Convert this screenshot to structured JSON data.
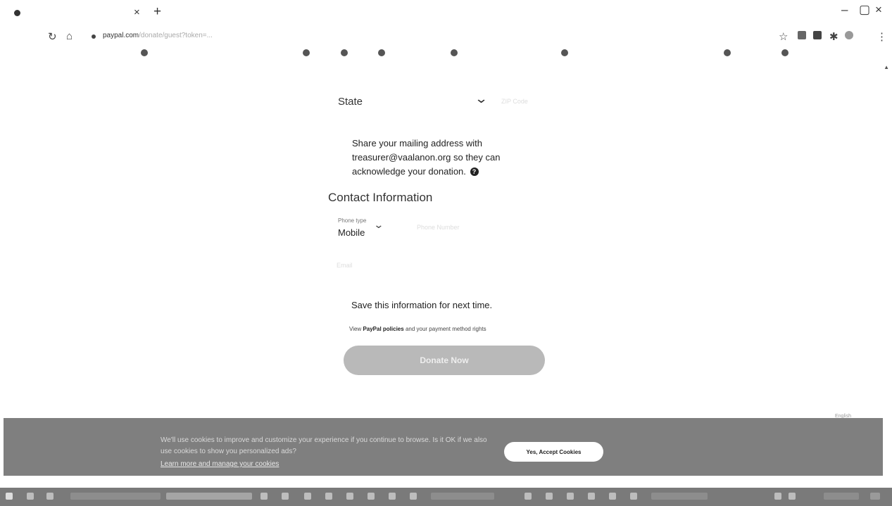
{
  "browser": {
    "url_host": "paypal.com",
    "url_rest": "/donate/guest?token=...",
    "tab_close_glyph": "×",
    "new_tab_glyph": "+",
    "minimize_glyph": "–",
    "maximize_glyph": "▢",
    "close_glyph": "×",
    "reload_icon": "reload-icon",
    "home_icon": "home-icon"
  },
  "form": {
    "state_label": "State",
    "share_text": "Share your mailing address with treasurer@vaalanon.org so they can acknowledge your donation.",
    "help_glyph": "?",
    "contact_heading": "Contact Information",
    "phone_type_label": "Phone type",
    "phone_type_value": "Mobile",
    "save_info": "Save this information for next time.",
    "policies_prefix": "View",
    "policies_link": "PayPal policies",
    "policies_suffix": "and your payment method rights",
    "donate_button": "Donate Now"
  },
  "cookie_banner": {
    "text": "We'll use cookies to improve and customize your experience if you continue to browse. Is it OK if we also use cookies to show you personalized ads?",
    "link": "Learn more and manage your cookies",
    "accept_button": "Yes, Accept Cookies"
  },
  "colors": {
    "donate_button_bg": "#b9b9b9",
    "cookie_banner_bg": "#7f7f7f",
    "taskbar_bg": "#7a7a7a"
  }
}
